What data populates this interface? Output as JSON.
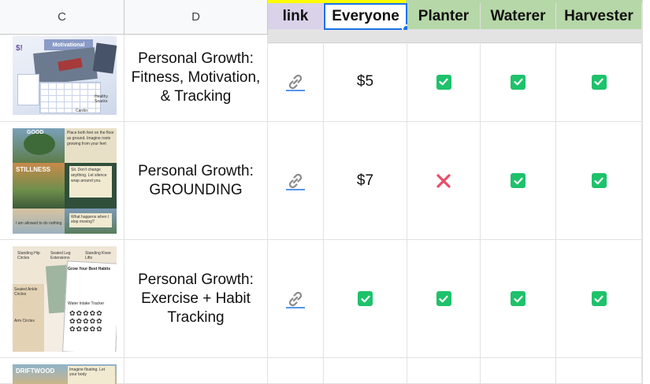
{
  "columns": {
    "c": "C",
    "d": "D"
  },
  "headers": {
    "link": "link",
    "everyone": "Everyone",
    "planter": "Planter",
    "waterer": "Waterer",
    "harvester": "Harvester"
  },
  "colors": {
    "link_header_bg": "#d9d2e9",
    "tier_header_bg": "#b6d7a8",
    "yellow_strip": "#ffff00",
    "selection": "#1a73e8",
    "check": "#1ec26b",
    "cross": "#ea4c6a"
  },
  "rows": [
    {
      "title": "Personal Growth: Fitness, Motivation, & Tracking",
      "price": "$5",
      "thumb_text": [
        "Motivational",
        "Healthy Snacks",
        "Cardio"
      ],
      "planter": "check"
    },
    {
      "title": "Personal Growth: GROUNDING",
      "price": "$7",
      "thumb_text": [
        "GOOD",
        "STILLNESS",
        "Place both feet on the floor as ground. Imagine roots growing from your feet",
        "Sit. Don't change anything. Let silence wrap around you.",
        "What happens when I stop moving?",
        "I am allowed to do nothing"
      ],
      "planter": "cross"
    },
    {
      "title": "Personal Growth: Exercise + Habit Tracking",
      "price": null,
      "thumb_text": [
        "Standing Hip Circles",
        "Seated Leg Extensions",
        "Standing Knee Lifts",
        "Seated Ankle Circles",
        "Arm Circles",
        "Grow Your Best Habits",
        "Water Intake Tracker"
      ],
      "planter": "check"
    },
    {
      "thumb_text": [
        "DRIFTWOOD",
        "Imagine floating. Let your body"
      ]
    }
  ]
}
